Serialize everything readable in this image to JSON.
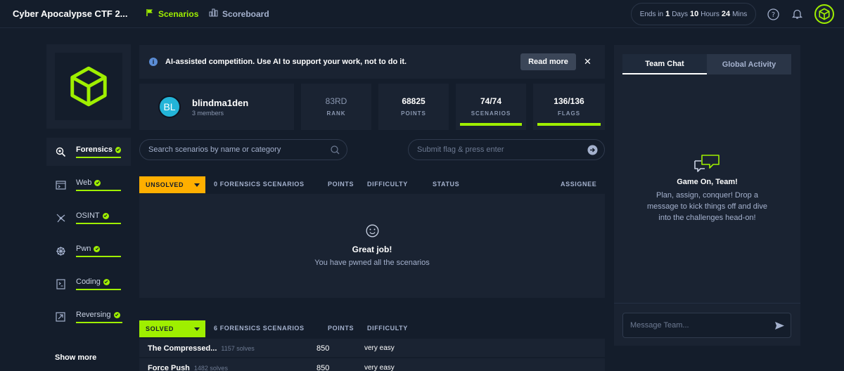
{
  "header": {
    "title": "Cyber Apocalypse CTF 2...",
    "nav": [
      {
        "label": "Scenarios"
      },
      {
        "label": "Scoreboard"
      }
    ],
    "timer": {
      "prefix": "Ends in",
      "days_num": "1",
      "days": "Days",
      "hours_num": "10",
      "hours": "Hours",
      "mins_num": "24",
      "mins": "Mins"
    }
  },
  "sidebar": {
    "categories": [
      {
        "label": "Forensics",
        "icon": "forensics-icon"
      },
      {
        "label": "Web",
        "icon": "web-icon"
      },
      {
        "label": "OSINT",
        "icon": "osint-icon"
      },
      {
        "label": "Pwn",
        "icon": "pwn-icon"
      },
      {
        "label": "Coding",
        "icon": "coding-icon"
      },
      {
        "label": "Reversing",
        "icon": "reversing-icon"
      }
    ],
    "show_more": "Show more"
  },
  "banner": {
    "text": "AI-assisted competition. Use AI to support your work, not to do it.",
    "button": "Read more",
    "close": "✕",
    "info": "i"
  },
  "team": {
    "initials": "BL",
    "name": "blindma1den",
    "members": "3 members"
  },
  "stats": {
    "rank": {
      "value": "83RD",
      "label": "RANK"
    },
    "points": {
      "value": "68825",
      "label": "POINTS"
    },
    "scenarios": {
      "value": "74/74",
      "label": "SCENARIOS",
      "progress": 1.0
    },
    "flags": {
      "value": "136/136",
      "label": "FLAGS",
      "progress": 1.0
    }
  },
  "search": {
    "placeholder": "Search scenarios by name or category"
  },
  "flag": {
    "placeholder": "Submit flag & press enter"
  },
  "unsolved": {
    "tag": "UNSOLVED",
    "columns": [
      "0 FORENSICS SCENARIOS",
      "POINTS",
      "DIFFICULTY",
      "STATUS",
      "ASSIGNEE"
    ],
    "empty_title": "Great job!",
    "empty_sub": "You have pwned all the scenarios"
  },
  "solved": {
    "tag": "SOLVED",
    "columns": [
      "6 FORENSICS SCENARIOS",
      "POINTS",
      "DIFFICULTY"
    ],
    "rows": [
      {
        "name": "The Compressed...",
        "solves": "1157 solves",
        "points": "850",
        "difficulty": "very easy"
      },
      {
        "name": "Force Push",
        "solves": "1482 solves",
        "points": "850",
        "difficulty": "very easy"
      }
    ]
  },
  "chat": {
    "tabs": [
      {
        "label": "Team Chat"
      },
      {
        "label": "Global Activity"
      }
    ],
    "title": "Game On, Team!",
    "desc": "Plan, assign, conquer! Drop a message to kick things off and dive into the challenges head-on!",
    "placeholder": "Message Team..."
  },
  "colors": {
    "accent": "#9fef00",
    "unsolved": "#ffaf00",
    "bg": "#141d2b",
    "panel": "#1a2332"
  }
}
